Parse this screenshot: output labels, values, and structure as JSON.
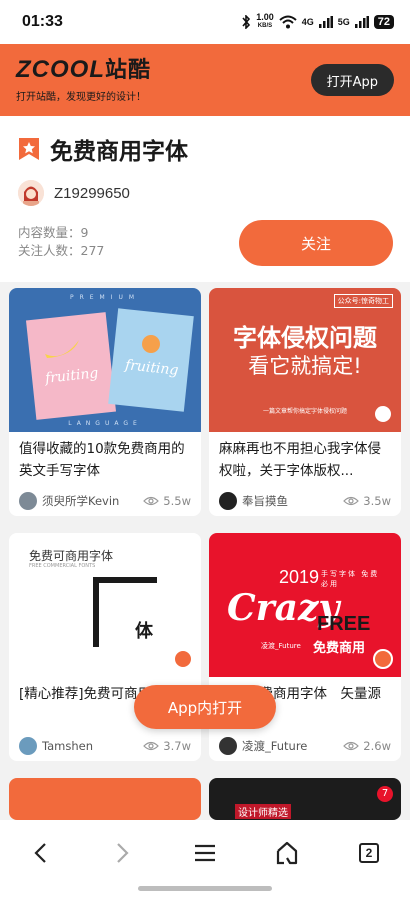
{
  "status_bar": {
    "time": "01:33",
    "net_speed": "1.00",
    "net_unit": "KB/S",
    "signal1": "4G",
    "signal2": "5G",
    "battery": "72"
  },
  "banner": {
    "logo": "ZCOOL",
    "logo_cn": "站酷",
    "slogan": "打开站酷，发现更好的设计！",
    "open_app_label": "打开App"
  },
  "header": {
    "title": "免费商用字体",
    "author": "Z19299650",
    "content_count": "内容数量：9",
    "follower_count": "关注人数：277",
    "follow_label": "关注"
  },
  "cards": [
    {
      "title": "值得收藏的10款免费商用的英文手写字体",
      "author": "须臾所学Kevin",
      "views": "5.5w",
      "thumb_top_text": "PREMIUM",
      "thumb_script": "fruiting",
      "thumb_bottom_text": "LANGUAGE"
    },
    {
      "title": "麻麻再也不用担心我字体侵权啦，关于字体版权...",
      "author": "奉旨摸鱼",
      "views": "3.5w",
      "thumb_tag": "公众号:惊奇物工",
      "thumb_line1": "字体侵权问题",
      "thumb_line2": "看它就搞定!",
      "thumb_small": "一篇文章帮你搞定字体侵权问题"
    },
    {
      "title": "[精心推荐]免费可商用字体",
      "author": "Tamshen",
      "views": "3.7w",
      "thumb_heading": "免费可商用字体",
      "thumb_sub": "FREE COMMERCIAL FONTS",
      "thumb_char": "体"
    },
    {
      "title": "手写免费商用字体　矢量源文件【...",
      "author": "凌渡_Future",
      "views": "2.6w",
      "thumb_year": "2019",
      "thumb_cn_top": "手写字体 免费必用",
      "thumb_script": "Crazy",
      "thumb_free": "FREE",
      "thumb_free_cn": "免费商用",
      "thumb_credit": "凌渡_Future"
    }
  ],
  "bottom_cards": {
    "right_tag": "设计师精选",
    "right_badge": "7"
  },
  "floating_button": "App内打开",
  "nav": {
    "tabs_count": "2"
  },
  "colors": {
    "accent": "#f26a3c",
    "dark": "#2b2b2b"
  }
}
